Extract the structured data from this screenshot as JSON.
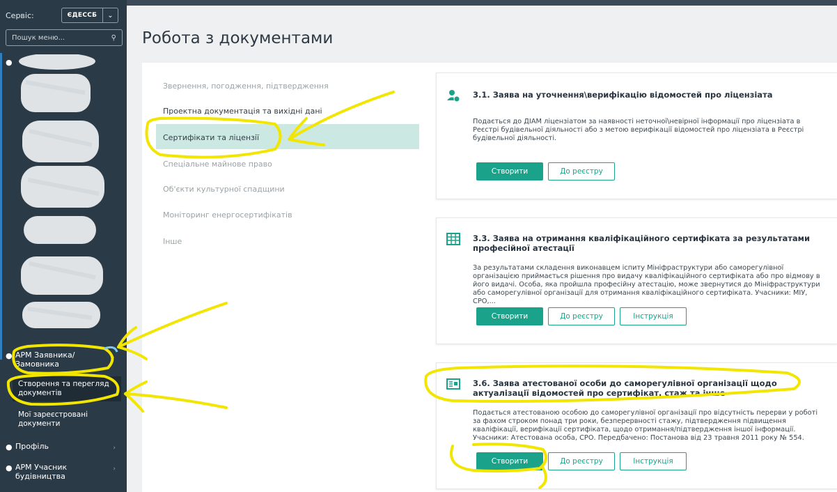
{
  "sidebar": {
    "service_label": "Сервіс:",
    "service_value": "ЄДЕССБ",
    "search_placeholder": "Пошук меню...",
    "arm_customer": "АРМ Заявника/ Замовника",
    "sub_create_view": "Створення та перегляд документів",
    "sub_registered": "Мої зареєстровані документи",
    "profile": "Профіль",
    "arm_participant": "АРМ Учасник будівництва"
  },
  "page": {
    "title": "Робота з документами"
  },
  "categories": [
    "Звернення, погодження, підтвердження",
    "Проектна документація та вихідні дані",
    "Сертифікати та ліцензії",
    "Спеціальне майнове право",
    "Об'єкти культурної спадщини",
    "Моніторинг енергосертифікатів",
    "Інше"
  ],
  "cards": [
    {
      "title": "3.1. Заява на уточнення\\верифікацію відомостей про ліцензіата",
      "desc": "Подається до ДІАМ ліцензіатом за наявності неточної\\невірної інформації про ліцензіата в Реєстрі будівельної діяльності або з метою верифікації відомостей про ліцензіата в Реєстрі будівельної діяльності.",
      "btn_create": "Створити",
      "btn_registry": "До реєстру"
    },
    {
      "title": "3.3. Заява на отримання кваліфікаційного сертифіката за результатами професійної атестації",
      "desc": "За результатами складення виконавцем іспиту Мініфраструктури або саморегулівної організацією приймається рішення про видачу кваліфікаційного сертифіката або про відмову в його видачі. Особа, яка пройшла професійну атестацію, може звернутися до Мініфраструктури або саморегулівної організації для отримання кваліфікаційного сертифіката. Учасники: МІУ, СРО,...",
      "btn_create": "Створити",
      "btn_registry": "До реєстру",
      "btn_instruction": "Інструкція"
    },
    {
      "title": "3.6. Заява атестованої особи до саморегулівної організації щодо актуалізації відомостей про сертифікат, стаж та інше",
      "desc": "Подається атестованою особою до саморегулівної організації про відсутність перерви у роботі за фахом строком понад три роки, безперервності стажу, підтвердження підвищення кваліфікації, верифікації сертифіката, щодо отримання/підтвердження іншої інформації. Учасники: Атестована особа, СРО. Передбачено: Постанова від 23 травня 2011 року № 554.",
      "btn_create": "Створити",
      "btn_registry": "До реєстру",
      "btn_instruction": "Інструкція"
    }
  ],
  "colors": {
    "accent": "#1aa38a",
    "sidebar": "#2b3a47",
    "highlight": "#cbe8e3",
    "annotation": "#f2e600"
  }
}
